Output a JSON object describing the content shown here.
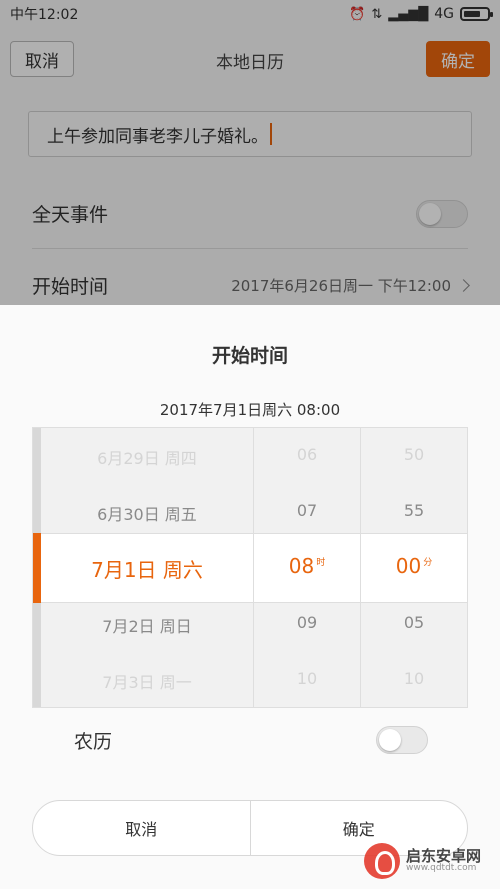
{
  "status_bar": {
    "time": "中午12:02",
    "network": "4G"
  },
  "nav": {
    "cancel_label": "取消",
    "title": "本地日历",
    "confirm_label": "确定"
  },
  "form": {
    "event_title_value": "上午参加同事老李儿子婚礼。",
    "allday_label": "全天事件",
    "allday_on": false,
    "start_label": "开始时间",
    "start_value": "2017年6月26日周一 下午12:00"
  },
  "sheet": {
    "title": "开始时间",
    "subtitle": "2017年7月1日周六 08:00",
    "date_wheel": [
      "6月29日 周四",
      "6月30日 周五",
      "7月1日 周六",
      "7月2日 周日",
      "7月3日 周一"
    ],
    "hour_wheel": [
      "06",
      "07",
      "08",
      "09",
      "10"
    ],
    "hour_unit": "时",
    "minute_wheel": [
      "50",
      "55",
      "00",
      "05",
      "10"
    ],
    "minute_unit": "分",
    "lunar_label": "农历",
    "lunar_on": false,
    "cancel_label": "取消",
    "confirm_label": "确定"
  },
  "watermark": {
    "name": "启东安卓网",
    "url": "www.qdtdt.com"
  },
  "colors": {
    "accent": "#e8650e",
    "background": "#f7f7f7"
  }
}
